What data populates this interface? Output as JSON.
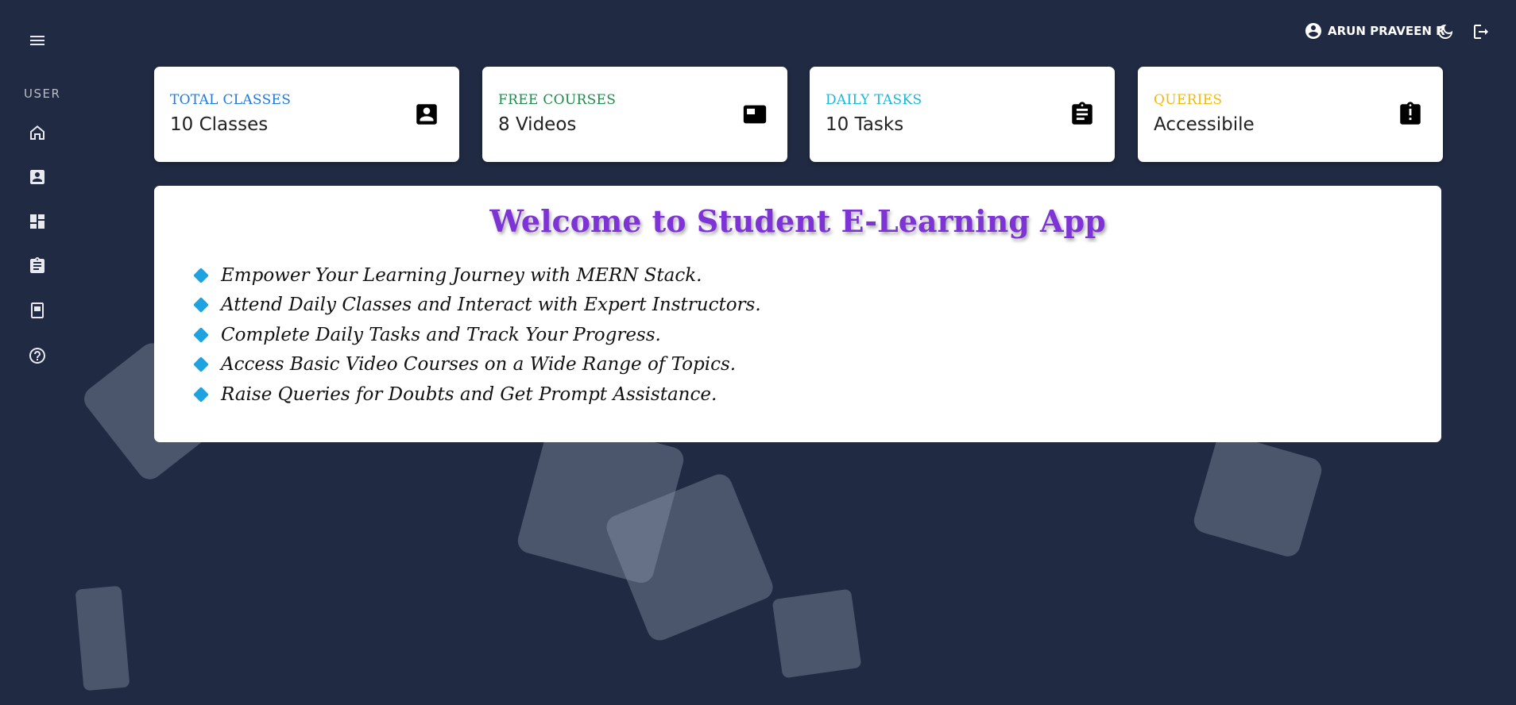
{
  "sidebar": {
    "section_label": "USER",
    "items": [
      {
        "icon": "home-icon",
        "label": "Home"
      },
      {
        "icon": "classes-icon",
        "label": "Classes"
      },
      {
        "icon": "dashboard-icon",
        "label": "Courses"
      },
      {
        "icon": "tasks-icon",
        "label": "Tasks"
      },
      {
        "icon": "book-icon",
        "label": "Library"
      },
      {
        "icon": "help-icon",
        "label": "Queries"
      }
    ]
  },
  "header": {
    "user_name": "ARUN PRAVEEN R",
    "icons": [
      "account-circle-icon",
      "dark-mode-icon",
      "logout-icon"
    ]
  },
  "cards": [
    {
      "title": "TOTAL CLASSES",
      "value": "10 Classes",
      "color": "#1e79e0",
      "icon": "contact-card-icon"
    },
    {
      "title": "FREE COURSES",
      "value": "8 Videos",
      "color": "#1e8a4c",
      "icon": "video-window-icon"
    },
    {
      "title": "DAILY TASKS",
      "value": "10 Tasks",
      "color": "#19b8d8",
      "icon": "clipboard-icon"
    },
    {
      "title": "QUERIES",
      "value": "Accessibile",
      "color": "#f2b90c",
      "icon": "clipboard-alert-icon"
    }
  ],
  "welcome": {
    "title": "Welcome to Student E-Learning App",
    "title_color": "#7e33d6",
    "features": [
      "Empower Your Learning Journey with MERN Stack.",
      "Attend Daily Classes and Interact with Expert Instructors.",
      "Complete Daily Tasks and Track Your Progress.",
      "Access Basic Video Courses on a Wide Range of Topics.",
      "Raise Queries for Doubts and Get Prompt Assistance."
    ]
  },
  "colors": {
    "background": "#202a42",
    "bullet": "#1fa3e0"
  }
}
